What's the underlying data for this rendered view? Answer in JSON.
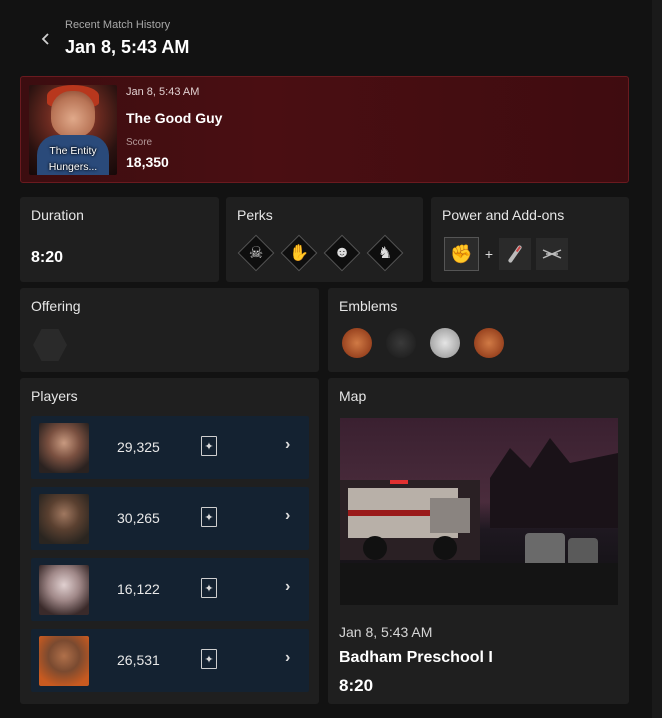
{
  "header": {
    "subtitle": "Recent Match History",
    "title": "Jan 8, 5:43 AM"
  },
  "match": {
    "date": "Jan 8, 5:43 AM",
    "killer_name": "The Good Guy",
    "portrait_caption_line1": "The Entity",
    "portrait_caption_line2": "Hungers...",
    "score_label": "Score",
    "score_value": "18,350"
  },
  "duration": {
    "label": "Duration",
    "value": "8:20"
  },
  "perks": {
    "label": "Perks",
    "items": [
      {
        "icon": "perk-icon-1"
      },
      {
        "icon": "perk-icon-2"
      },
      {
        "icon": "perk-icon-3"
      },
      {
        "icon": "perk-icon-4"
      }
    ]
  },
  "power": {
    "label": "Power and Add-ons",
    "plus": "+",
    "power_icon": "power-icon",
    "addons": [
      {
        "icon": "addon-icon-1"
      },
      {
        "icon": "addon-icon-2"
      }
    ]
  },
  "offering": {
    "label": "Offering"
  },
  "emblems": {
    "label": "Emblems",
    "items": [
      {
        "icon": "emblem-icon-1",
        "color": "#b0552a"
      },
      {
        "icon": "emblem-icon-2",
        "color": "#2a2a2a"
      },
      {
        "icon": "emblem-icon-3",
        "color": "#bfbfbf"
      },
      {
        "icon": "emblem-icon-4",
        "color": "#b0552a"
      }
    ]
  },
  "players": {
    "label": "Players",
    "rows": [
      {
        "score": "29,325"
      },
      {
        "score": "30,265"
      },
      {
        "score": "16,122"
      },
      {
        "score": "26,531"
      }
    ]
  },
  "map": {
    "label": "Map",
    "date": "Jan 8, 5:43 AM",
    "name": "Badham Preschool I",
    "duration": "8:20"
  },
  "colors": {
    "background": "#121212",
    "panel": "#1f1f1f",
    "match_card": "#4a0e12",
    "player_row": "#142231"
  }
}
